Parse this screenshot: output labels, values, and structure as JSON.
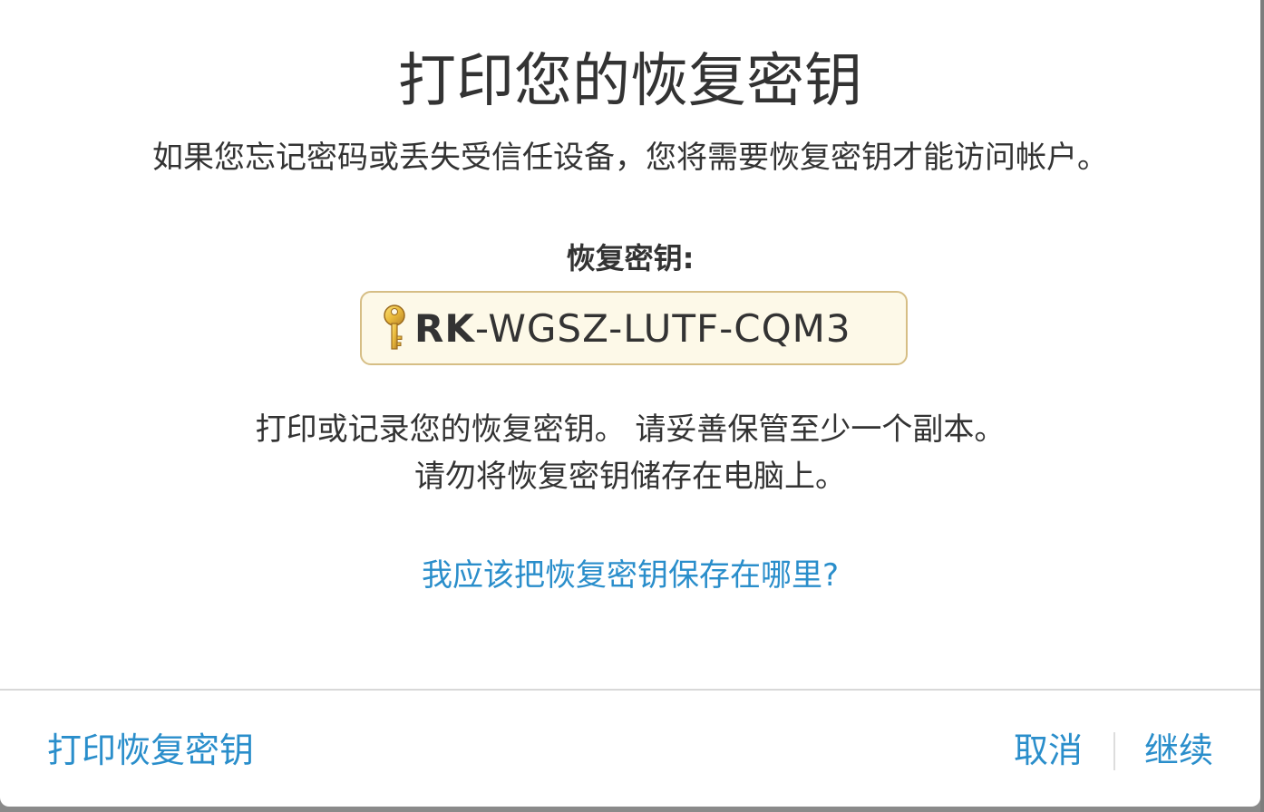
{
  "dialog": {
    "title": "打印您的恢复密钥",
    "subtitle": "如果您忘记密码或丢失受信任设备，您将需要恢复密钥才能访问帐户。",
    "key_label": "恢复密钥:",
    "key_prefix": "RK",
    "key_rest": "-WGSZ-LUTF-CQM3",
    "key_icon": "key-icon",
    "instructions_line1": "打印或记录您的恢复密钥。 请妥善保管至少一个副本。",
    "instructions_line2": "请勿将恢复密钥储存在电脑上。",
    "help_link": "我应该把恢复密钥保存在哪里?"
  },
  "footer": {
    "print_label": "打印恢复密钥",
    "cancel_label": "取消",
    "continue_label": "继续"
  },
  "colors": {
    "link": "#2a8ecb",
    "text": "#333333",
    "key_box_bg": "#fdf9e8",
    "key_box_border": "#d6be85"
  }
}
